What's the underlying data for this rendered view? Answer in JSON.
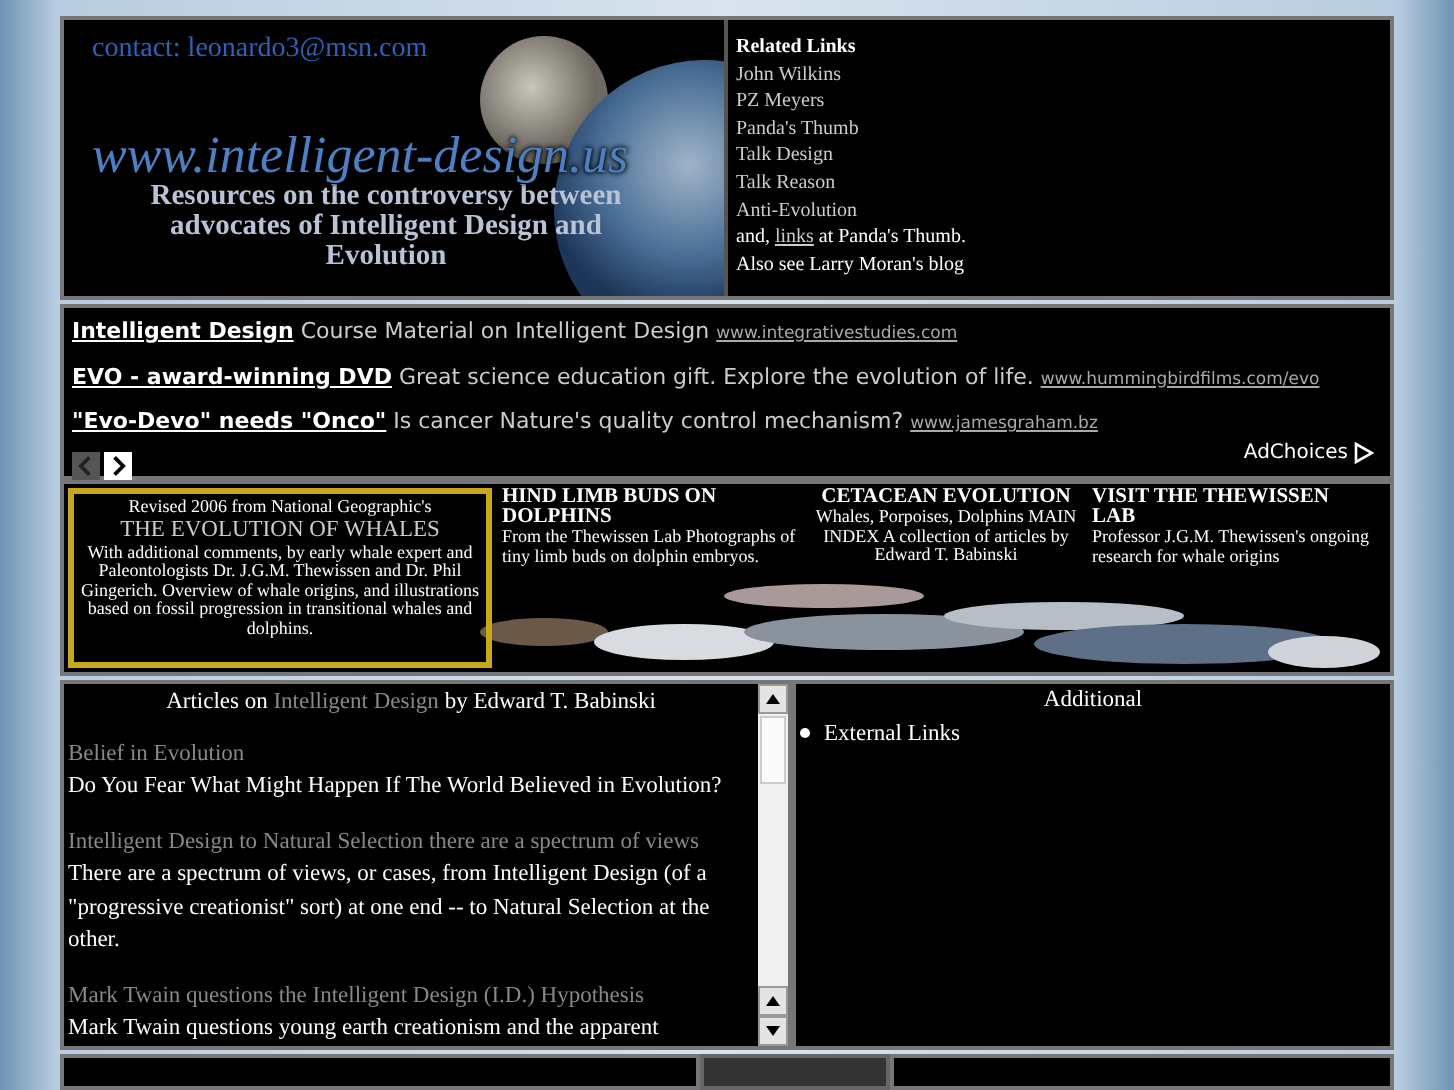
{
  "banner": {
    "contact": "contact: leonardo3@msn.com",
    "site": "www.intelligent-design.us",
    "tagline": "Resources on the controversy between advocates of Intelligent Design and Evolution"
  },
  "related_links": {
    "title": "Related Links",
    "items": [
      "John Wilkins",
      "PZ Meyers",
      "Panda's Thumb",
      "Talk Design",
      "Talk Reason",
      "Anti-Evolution"
    ],
    "note_before": "and,",
    "note_link": "links",
    "note_after": "at Panda's Thumb.",
    "blog": "Also see Larry Moran's blog"
  },
  "ads": [
    {
      "title": "Intelligent Design",
      "text": "Course Material on Intelligent Design",
      "url": "www.integrativestudies.com"
    },
    {
      "title": "EVO - award-winning DVD",
      "text": "Great science education gift. Explore the evolution of life.",
      "url": "www.hummingbirdfilms.com/evo"
    },
    {
      "title": "\"Evo-Devo\" needs \"Onco\"",
      "text": "Is cancer Nature's quality control mechanism?",
      "url": "www.jamesgraham.bz"
    }
  ],
  "ad_nav": [
    {
      "kind": "prev",
      "disabled": true
    },
    {
      "kind": "next",
      "disabled": false
    }
  ],
  "adchoices": "AdChoices",
  "whale_banner": {
    "revised": "Revised 2006 from National Geographic's",
    "title": "THE EVOLUTION OF WHALES",
    "text": "With additional comments, by early whale expert and Paleontologists Dr. J.G.M. Thewissen and Dr. Phil Gingerich. Overview of whale origins, and illustrations based on fossil progression in transitional whales and dolphins.",
    "columns": [
      {
        "heading": "HIND LIMB BUDS ON DOLPHINS",
        "text": "From the Thewissen Lab Photographs of tiny limb buds on dolphin embryos."
      },
      {
        "heading": "CETACEAN EVOLUTION",
        "text": "Whales, Porpoises, Dolphins MAIN INDEX A collection of articles by Edward T. Babinski"
      },
      {
        "heading": "VISIT THE THEWISSEN LAB",
        "text": "Professor J.G.M. Thewissen's ongoing research for whale origins"
      }
    ]
  },
  "articles": {
    "heading_before": "Articles on",
    "heading_link": "Intelligent Design",
    "heading_after": "by Edward T. Babinski",
    "items": [
      {
        "title": "Belief in Evolution",
        "summary": "Do You Fear What Might Happen If The World Believed in Evolution?"
      },
      {
        "title": "Intelligent Design to Natural Selection there are a spectrum of views",
        "summary": "There are a spectrum of views, or cases, from Intelligent Design (of a \"progressive creationist\" sort) at one end -- to Natural Selection at the other."
      },
      {
        "title": "Mark Twain questions the Intelligent Design (I.D.) Hypothesis",
        "summary": "Mark Twain questions young earth creationism and the apparent"
      }
    ]
  },
  "additional": {
    "title": "Additional",
    "items": [
      "External Links"
    ]
  }
}
